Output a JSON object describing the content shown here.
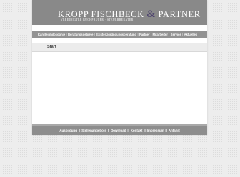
{
  "header": {
    "title_part1": "KROPP FISCHBECK",
    "title_amp": "&",
    "title_part2": "PARTNER",
    "subtitle": "VEREIDIGTER BUCHPRÜFER · STEUERBERATER"
  },
  "nav": {
    "items": [
      {
        "label": "Kanzleiphilosophie"
      },
      {
        "label": "Beratungsgebiete"
      },
      {
        "label": "Existenzgründungsberatung"
      },
      {
        "label": "Partner"
      },
      {
        "label": "Mitarbeiter"
      },
      {
        "label": "Service"
      },
      {
        "label": "Aktuelles"
      }
    ],
    "separator": "|"
  },
  "breadcrumb": {
    "current": "Start"
  },
  "footer": {
    "links": [
      {
        "label": "Ausbildung"
      },
      {
        "label": "Stellenangebote"
      },
      {
        "label": "Download"
      },
      {
        "label": "Kontakt"
      },
      {
        "label": "Impressum"
      },
      {
        "label": "Anfahrt"
      }
    ],
    "separator": "||"
  },
  "colors": {
    "header_bg": "#898989",
    "nav_bg": "#929292",
    "footer_bg": "#8d8d8d",
    "ampersand": "#4a3f6d"
  }
}
